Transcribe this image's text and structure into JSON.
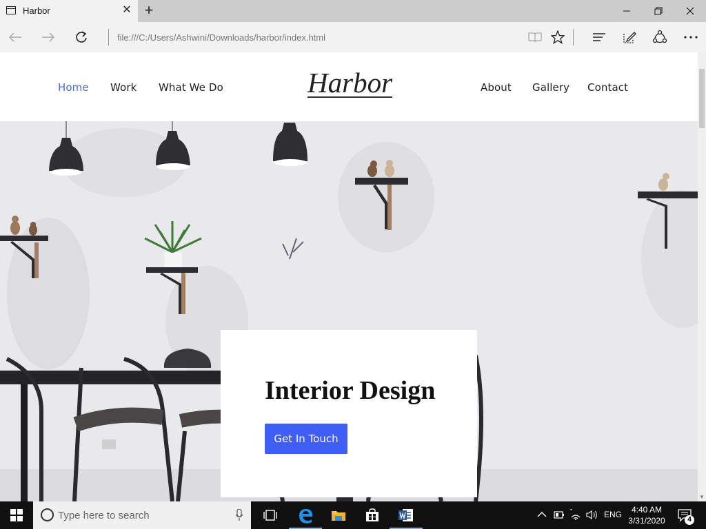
{
  "browser": {
    "tab": {
      "title": "Harbor",
      "close_icon": "close-icon"
    },
    "new_tab_icon": "plus-icon",
    "window_controls": [
      "minimize-icon",
      "restore-icon",
      "close-icon"
    ],
    "url": "file:///C:/Users/Ashwini/Downloads/harbor/index.html",
    "toolbar_icons": [
      "reading-view-icon",
      "favorite-star-icon",
      "hub-icon",
      "web-note-icon",
      "share-icon",
      "more-icon"
    ]
  },
  "site": {
    "logo": "Harbor",
    "nav_left": [
      {
        "label": "Home",
        "active": true
      },
      {
        "label": "Work",
        "active": false
      },
      {
        "label": "What We Do",
        "active": false
      }
    ],
    "nav_right": [
      {
        "label": "About"
      },
      {
        "label": "Gallery"
      },
      {
        "label": "Contact"
      }
    ],
    "hero": {
      "title": "Interior Design",
      "cta_label": "Get In Touch",
      "cta_color": "#3f5ef5"
    },
    "accent_color": "#4a6cd4"
  },
  "taskbar": {
    "search_placeholder": "Type here to search",
    "apps": [
      "task-view-icon",
      "edge-icon",
      "file-explorer-icon",
      "store-icon",
      "word-icon"
    ],
    "language": "ENG",
    "time": "4:40 AM",
    "date": "3/31/2020",
    "notification_count": "4"
  }
}
